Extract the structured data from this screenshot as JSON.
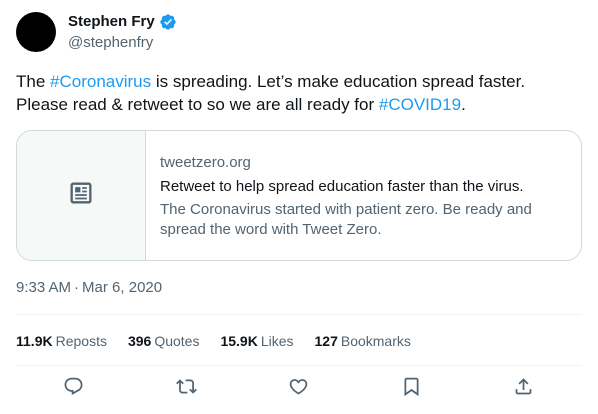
{
  "author": {
    "display_name": "Stephen Fry",
    "handle": "@stephenfry",
    "verified_icon": "verified-badge-icon"
  },
  "tweet": {
    "line1": {
      "pre": "The ",
      "tag": "#Coronavirus",
      "post": " is spreading. Let’s make education spread faster."
    },
    "line2": {
      "pre": "Please read & retweet to so we are all ready for ",
      "tag": "#COVID19",
      "post": "."
    }
  },
  "card": {
    "thumb_icon": "article-icon",
    "domain": "tweetzero.org",
    "title": "Retweet to help spread education faster than the virus.",
    "description": "The Coronavirus started with patient zero. Be ready and spread the word with Tweet Zero."
  },
  "timestamp": {
    "time": "9:33 AM",
    "separator": "·",
    "date": "Mar 6, 2020"
  },
  "stats": {
    "reposts": {
      "count": "11.9K",
      "label": "Reposts"
    },
    "quotes": {
      "count": "396",
      "label": "Quotes"
    },
    "likes": {
      "count": "15.9K",
      "label": "Likes"
    },
    "bookmarks": {
      "count": "127",
      "label": "Bookmarks"
    }
  },
  "actions": {
    "icons": [
      "reply-icon",
      "retweet-icon",
      "like-icon",
      "bookmark-icon",
      "share-icon"
    ]
  },
  "colors": {
    "accent": "#1d9bf0",
    "text": "#0f1419",
    "secondary_text": "#536471",
    "border": "#cfd9de"
  }
}
